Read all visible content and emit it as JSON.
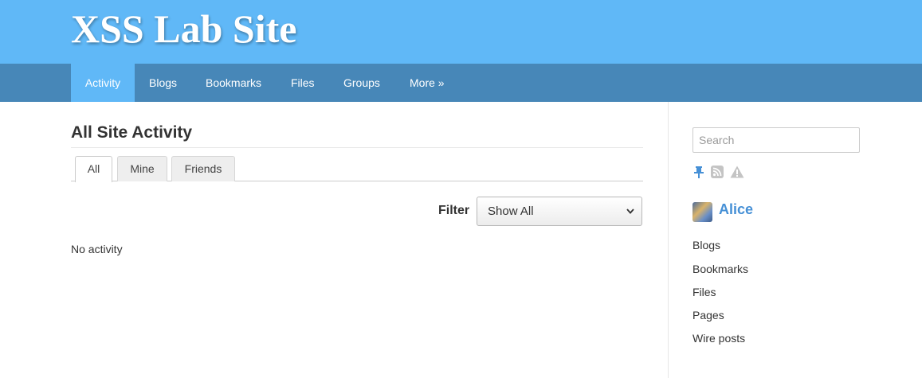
{
  "site": {
    "title": "XSS Lab Site"
  },
  "nav": {
    "items": [
      {
        "label": "Activity",
        "active": true
      },
      {
        "label": "Blogs"
      },
      {
        "label": "Bookmarks"
      },
      {
        "label": "Files"
      },
      {
        "label": "Groups"
      },
      {
        "label": "More »"
      }
    ]
  },
  "main": {
    "title": "All Site Activity",
    "tabs": [
      {
        "label": "All",
        "active": true
      },
      {
        "label": "Mine"
      },
      {
        "label": "Friends"
      }
    ],
    "filter": {
      "label": "Filter",
      "selected": "Show All"
    },
    "empty_message": "No activity"
  },
  "sidebar": {
    "search": {
      "placeholder": "Search"
    },
    "tools": [
      "pin-icon",
      "rss-icon",
      "report-icon"
    ],
    "owner": {
      "name": "Alice"
    },
    "links": [
      "Blogs",
      "Bookmarks",
      "Files",
      "Pages",
      "Wire posts"
    ]
  },
  "colors": {
    "header": "#60b8f7",
    "navbar": "#4787b8",
    "link_accent": "#4690d6"
  }
}
